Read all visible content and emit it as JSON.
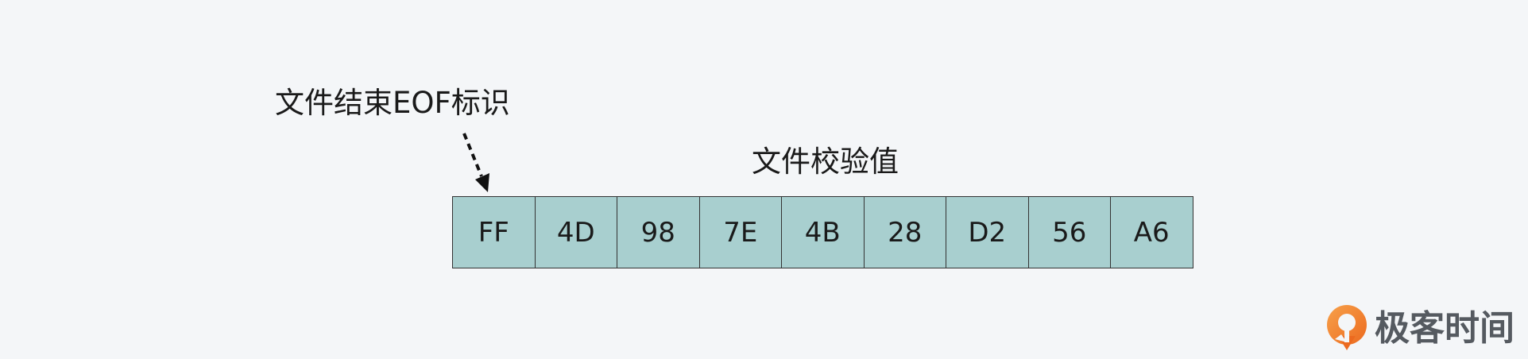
{
  "annotations": {
    "eof_label": "文件结束EOF标识",
    "checksum_label": "文件校验值"
  },
  "bytes": [
    "FF",
    "4D",
    "98",
    "7E",
    "4B",
    "28",
    "D2",
    "56",
    "A6"
  ],
  "brand": {
    "name": "极客时间",
    "icon": "geektime-logo-icon",
    "accent_color": "#f0782a"
  },
  "colors": {
    "cell_fill": "#a8cfcf",
    "background": "#f4f6f8"
  }
}
